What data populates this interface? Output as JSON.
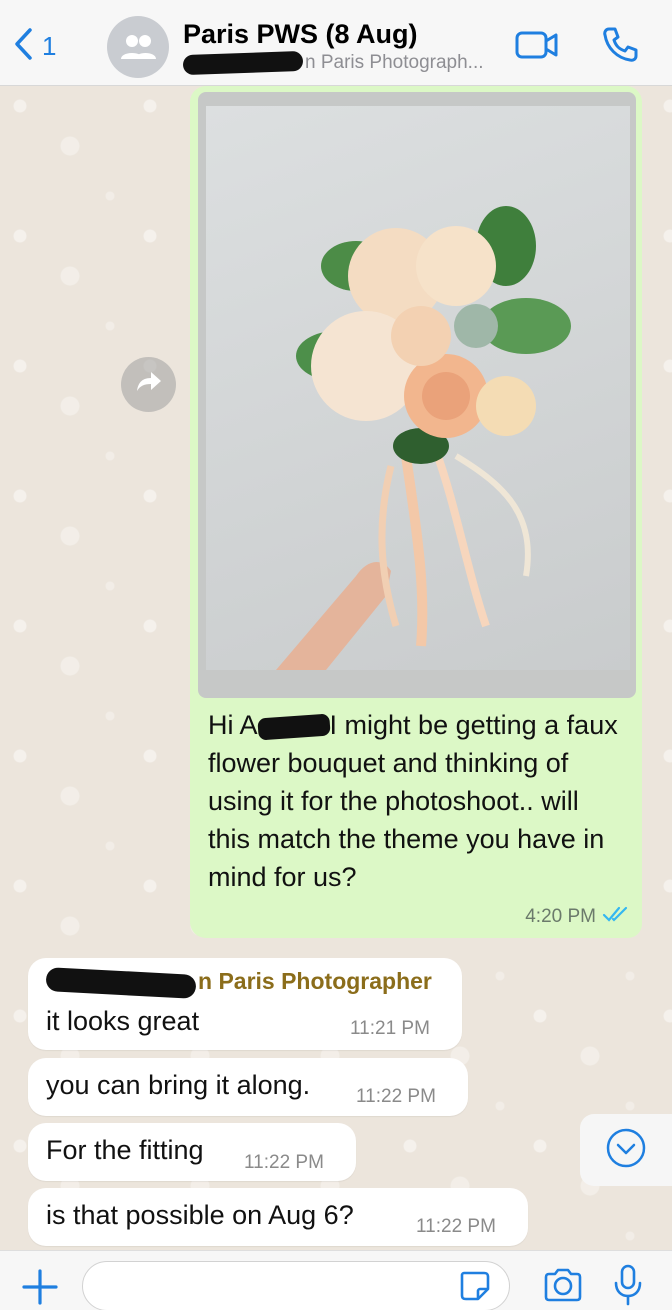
{
  "header": {
    "back_count": "1",
    "title": "Paris PWS (8 Aug)",
    "subtitle": "n Paris Photograph..."
  },
  "messages": {
    "outgoing": {
      "text_before": "Hi A",
      "text_after": "I might be getting a faux flower bouquet and thinking of using it for the photoshoot.. will this match the theme you have in mind for us?",
      "time": "4:20 PM",
      "status": "read"
    },
    "incoming": [
      {
        "sender": "n Paris Photographer",
        "text": "it looks great",
        "time": "11:21 PM"
      },
      {
        "text": "you can bring it along.",
        "time": "11:22 PM"
      },
      {
        "text": "For the fitting",
        "time": "11:22 PM"
      },
      {
        "text": "is that possible on Aug 6?",
        "time": "11:22 PM"
      }
    ]
  },
  "composer": {
    "placeholder": ""
  },
  "colors": {
    "accent": "#1f7fe0",
    "outgoing_bubble": "#dcf8c6",
    "incoming_bubble": "#ffffff",
    "sender_name": "#8b6d1b",
    "read_ticks": "#34b7f1"
  },
  "icons": {
    "back": "chevron-left-icon",
    "avatar": "group-avatar-icon",
    "video": "video-camera-icon",
    "call": "phone-icon",
    "forward": "forward-arrow-icon",
    "scroll": "chevron-down-circle-icon",
    "plus": "plus-icon",
    "sticker": "sticker-icon",
    "camera": "camera-icon",
    "mic": "microphone-icon"
  }
}
